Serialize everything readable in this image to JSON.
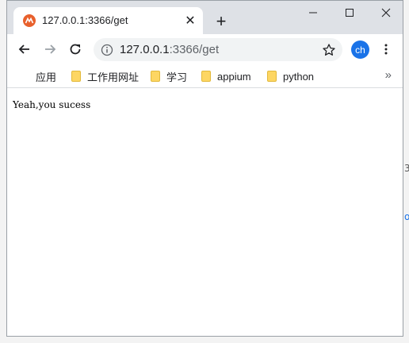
{
  "tab": {
    "title": "127.0.0.1:3366/get",
    "close_glyph": "✕"
  },
  "new_tab_glyph": "+",
  "window_controls": {
    "minimize": "minimize-icon",
    "maximize": "maximize-icon",
    "close": "close-icon"
  },
  "address": {
    "host": "127.0.0.1",
    "path": ":3366/get"
  },
  "profile": {
    "initials": "ch",
    "color": "#1a73e8"
  },
  "bookmarks": [
    {
      "label": "应用",
      "icon": "apps-grid-icon"
    },
    {
      "label": "工作用网址",
      "icon": "folder-icon"
    },
    {
      "label": "学习",
      "icon": "folder-icon"
    },
    {
      "label": "appium",
      "icon": "folder-icon"
    },
    {
      "label": "python",
      "icon": "folder-icon"
    }
  ],
  "bookmarks_more_glyph": "»",
  "page": {
    "text": "Yeah,you sucess"
  },
  "background_fragments": {
    "digit": "3",
    "letter": "o"
  },
  "colors": {
    "tabstrip": "#dee1e6",
    "accent": "#1a73e8",
    "favicon": "#e8602c",
    "folder": "#fdd663"
  }
}
